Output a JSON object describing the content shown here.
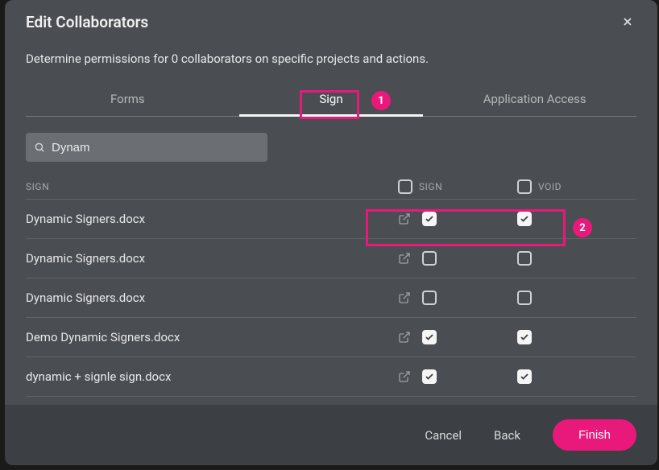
{
  "header": {
    "title": "Edit  Collaborators"
  },
  "description": "Determine permissions for 0 collaborators on specific projects and actions.",
  "tabs": {
    "forms": "Forms",
    "sign": "Sign",
    "access": "Application Access"
  },
  "search": {
    "value": "Dynam"
  },
  "table": {
    "header_name": "SIGN",
    "header_sign": "SIGN",
    "header_void": "VOID"
  },
  "rows": [
    {
      "name": "Dynamic Signers.docx",
      "sign": true,
      "void": true
    },
    {
      "name": "Dynamic Signers.docx",
      "sign": false,
      "void": false
    },
    {
      "name": "Dynamic Signers.docx",
      "sign": false,
      "void": false
    },
    {
      "name": "Demo Dynamic Signers.docx",
      "sign": true,
      "void": true
    },
    {
      "name": "dynamic + signle sign.docx",
      "sign": true,
      "void": true
    }
  ],
  "footer": {
    "cancel": "Cancel",
    "back": "Back",
    "finish": "Finish"
  },
  "annotations": {
    "a1": "1",
    "a2": "2"
  }
}
